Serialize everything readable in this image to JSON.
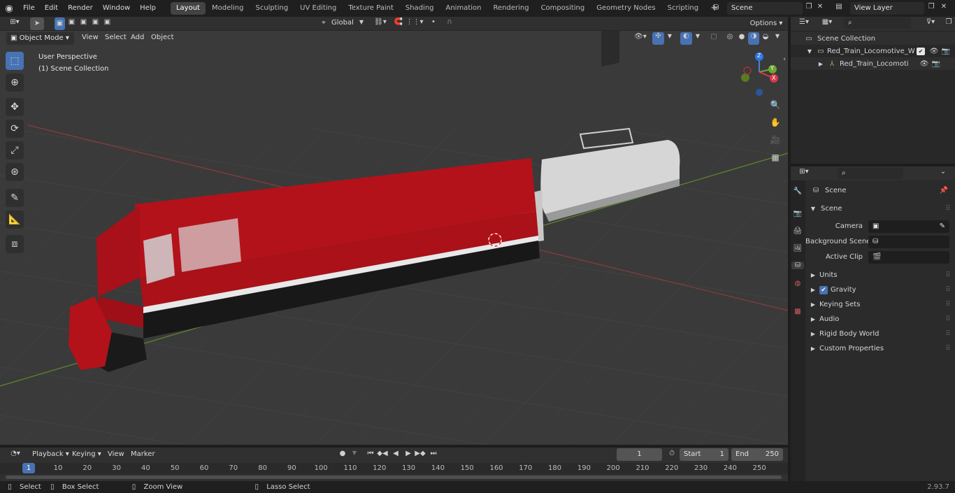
{
  "topbar": {
    "menus": [
      "File",
      "Edit",
      "Render",
      "Window",
      "Help"
    ],
    "workspaces": [
      "Layout",
      "Modeling",
      "Sculpting",
      "UV Editing",
      "Texture Paint",
      "Shading",
      "Animation",
      "Rendering",
      "Compositing",
      "Geometry Nodes",
      "Scripting"
    ],
    "active_workspace": "Layout",
    "scene_name": "Scene",
    "view_layer": "View Layer"
  },
  "viewport_header": {
    "transform": "Global",
    "options": "Options",
    "mode": "Object Mode",
    "menus": [
      "View",
      "Select",
      "Add",
      "Object"
    ]
  },
  "viewport": {
    "view_name": "User Perspective",
    "collection": "(1) Scene Collection"
  },
  "gizmo": {
    "z": "Z",
    "y": "Y",
    "x": "X"
  },
  "outliner": {
    "root": "Scene Collection",
    "items": [
      {
        "label": "Red_Train_Locomotive_With_"
      },
      {
        "label": "Red_Train_Locomotive_V"
      }
    ]
  },
  "properties": {
    "header": "Scene",
    "section": "Scene",
    "fields": [
      {
        "label": "Camera"
      },
      {
        "label": "Background Scene"
      },
      {
        "label": "Active Clip"
      }
    ],
    "panels": [
      "Units",
      "Gravity",
      "Keying Sets",
      "Audio",
      "Rigid Body World",
      "Custom Properties"
    ],
    "gravity_checked": true
  },
  "timeline": {
    "menus": [
      "Playback",
      "Keying",
      "View",
      "Marker"
    ],
    "current_frame": "1",
    "start_label": "Start",
    "start": "1",
    "end_label": "End",
    "end": "250",
    "ticks": [
      "10",
      "20",
      "30",
      "40",
      "50",
      "60",
      "70",
      "80",
      "90",
      "100",
      "110",
      "120",
      "130",
      "140",
      "150",
      "160",
      "170",
      "180",
      "190",
      "200",
      "210",
      "220",
      "230",
      "240",
      "250"
    ],
    "ruler_current": "1"
  },
  "statusbar": {
    "select": "Select",
    "box_select": "Box Select",
    "zoom_view": "Zoom View",
    "lasso_select": "Lasso Select",
    "version": "2.93.7"
  },
  "colors": {
    "accent": "#4772b3",
    "locomotive": "#b5121b",
    "grid_red": "#a33a3a",
    "grid_green": "#6a9a3a"
  }
}
